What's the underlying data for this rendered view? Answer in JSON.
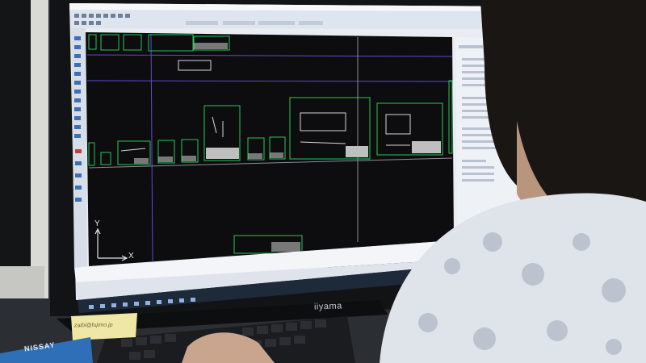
{
  "scene": {
    "description_free": true,
    "monitor": {
      "brand": "iiyama"
    },
    "sticky_note": {
      "text": "zaibi@fujimo.jp"
    },
    "badge": {
      "text": "NISSAY"
    },
    "cad": {
      "axis_y": "Y",
      "axis_x": "X",
      "background_color": "#0d0d0f",
      "frame_color": "#28c75a",
      "guide_color": "#5c4bd6"
    },
    "colors": {
      "wall": "#26282c",
      "monitor_bezel": "#121315",
      "shirt": "#dfe3ea",
      "hair": "#1a1614",
      "skin": "#c9a58d"
    }
  }
}
